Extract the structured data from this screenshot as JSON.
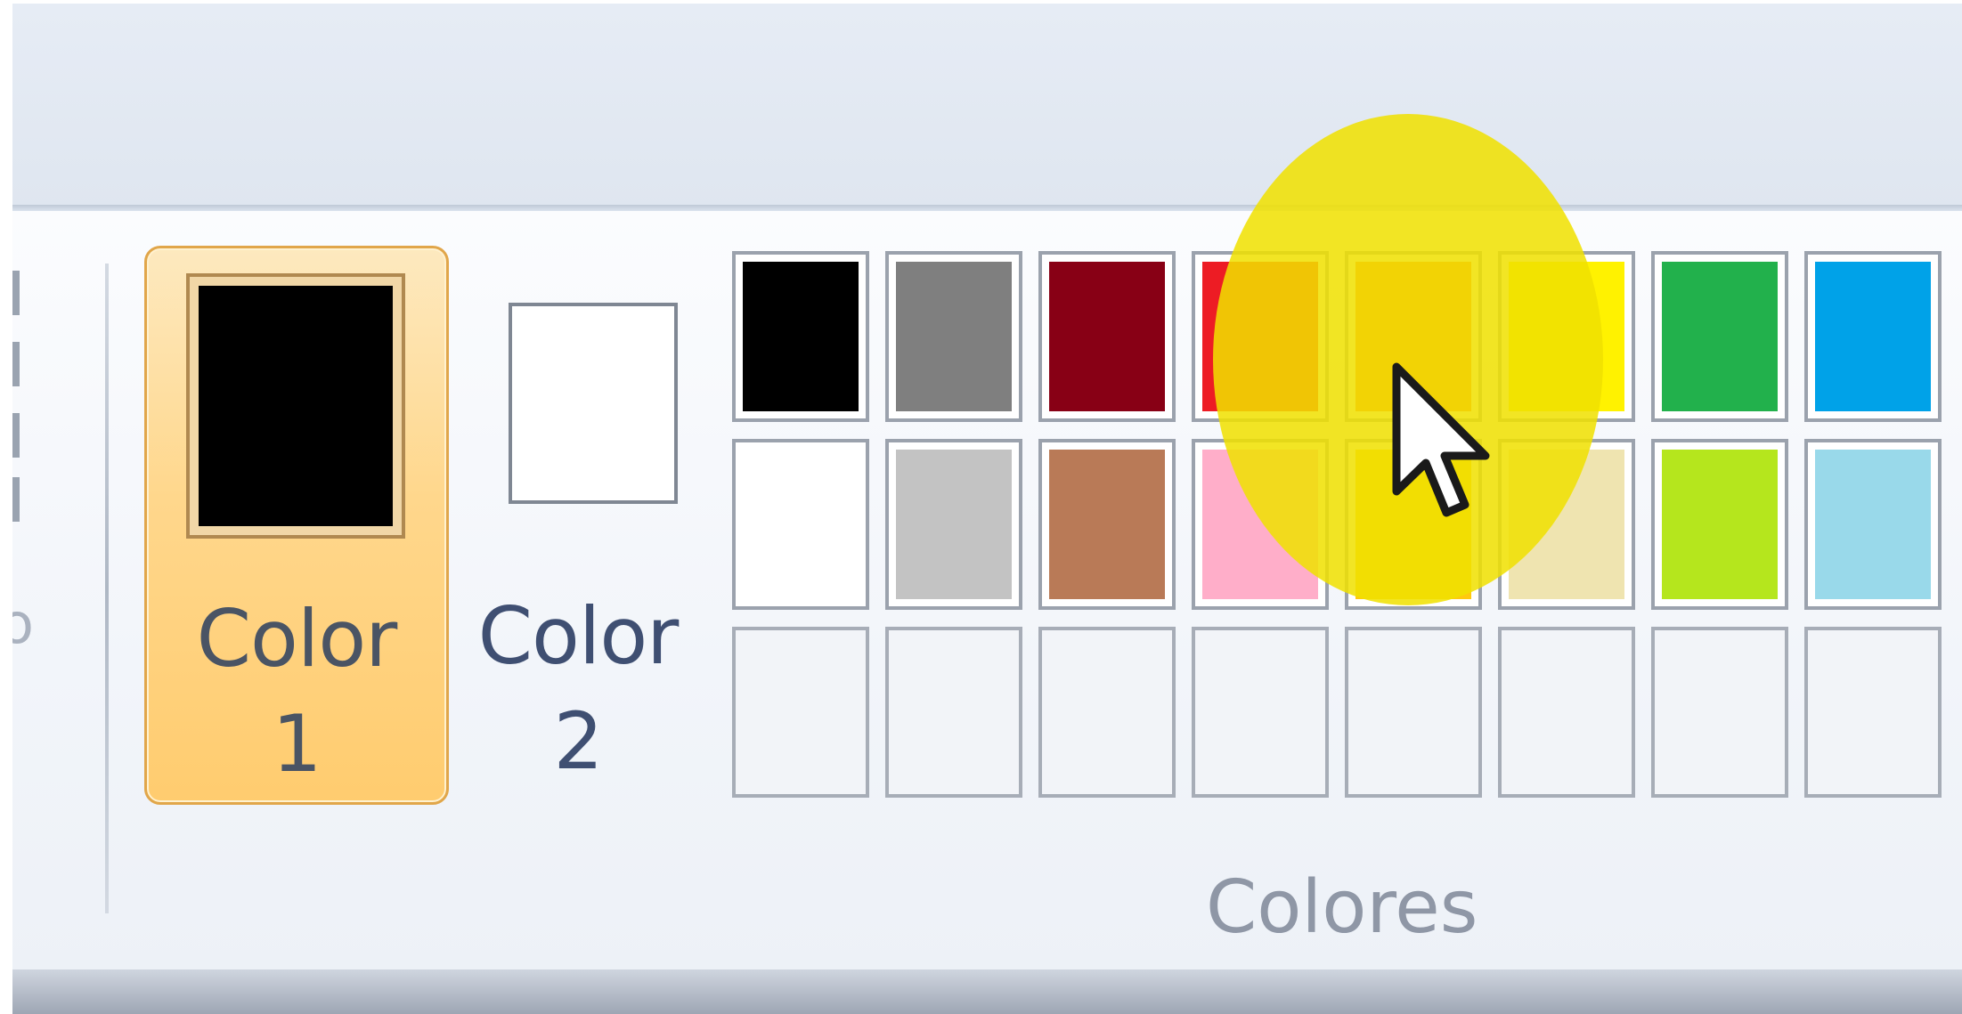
{
  "ribbon": {
    "previous_group_label_fragment": "o",
    "color1": {
      "label_line1": "Color",
      "label_line2": "1",
      "value": "#000000",
      "selected": true
    },
    "color2": {
      "label_line1": "Color",
      "label_line2": "2",
      "value": "#ffffff",
      "selected": false
    },
    "group_label": "Colores",
    "palette": {
      "row1": [
        "#000000",
        "#7f7f7f",
        "#880015",
        "#ed1c24",
        "#ff7f27",
        "#fff200",
        "#22b14c",
        "#00a2e8"
      ],
      "row2": [
        "#ffffff",
        "#c3c3c3",
        "#b97a57",
        "#ffaec9",
        "#ffc90e",
        "#efe4b0",
        "#b5e61d",
        "#99d9ea"
      ],
      "row3": [
        "",
        "",
        "",
        "",
        "",
        "",
        "",
        ""
      ]
    }
  },
  "overlay": {
    "highlight_color": "#f0e100",
    "cursor_icon": "arrow-pointer-icon"
  }
}
